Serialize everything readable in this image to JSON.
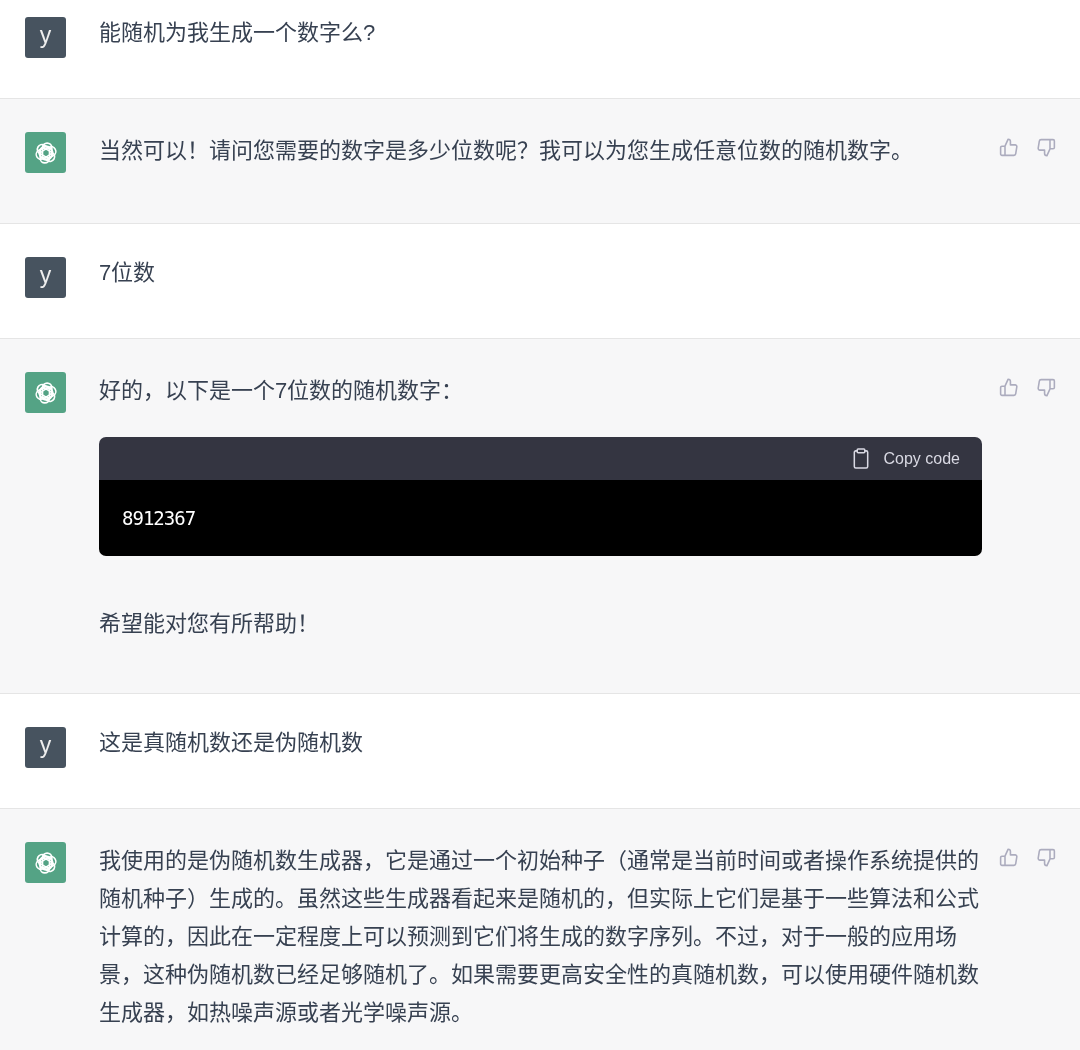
{
  "messages": [
    {
      "kind": "user",
      "avatar": "y",
      "text": "能随机为我生成一个数字么?"
    },
    {
      "kind": "assistant",
      "blocks": [
        {
          "kind": "paragraph",
          "text": "当然可以！请问您需要的数字是多少位数呢？我可以为您生成任意位数的随机数字。"
        }
      ]
    },
    {
      "kind": "user",
      "avatar": "y",
      "text": "7位数"
    },
    {
      "kind": "assistant",
      "blocks": [
        {
          "kind": "paragraph",
          "text": "好的，以下是一个7位数的随机数字："
        },
        {
          "kind": "code",
          "copy_label": "Copy code",
          "code": "8912367"
        },
        {
          "kind": "paragraph",
          "text": "希望能对您有所帮助！"
        }
      ]
    },
    {
      "kind": "user",
      "avatar": "y",
      "text": "这是真随机数还是伪随机数"
    },
    {
      "kind": "assistant",
      "blocks": [
        {
          "kind": "paragraph",
          "text": "我使用的是伪随机数生成器，它是通过一个初始种子（通常是当前时间或者操作系统提供的随机种子）生成的。虽然这些生成器看起来是随机的，但实际上它们是基于一些算法和公式计算的，因此在一定程度上可以预测到它们将生成的数字序列。不过，对于一般的应用场景，这种伪随机数已经足够随机了。如果需要更高安全性的真随机数，可以使用硬件随机数生成器，如热噪声源或者光学噪声源。"
        }
      ]
    }
  ]
}
